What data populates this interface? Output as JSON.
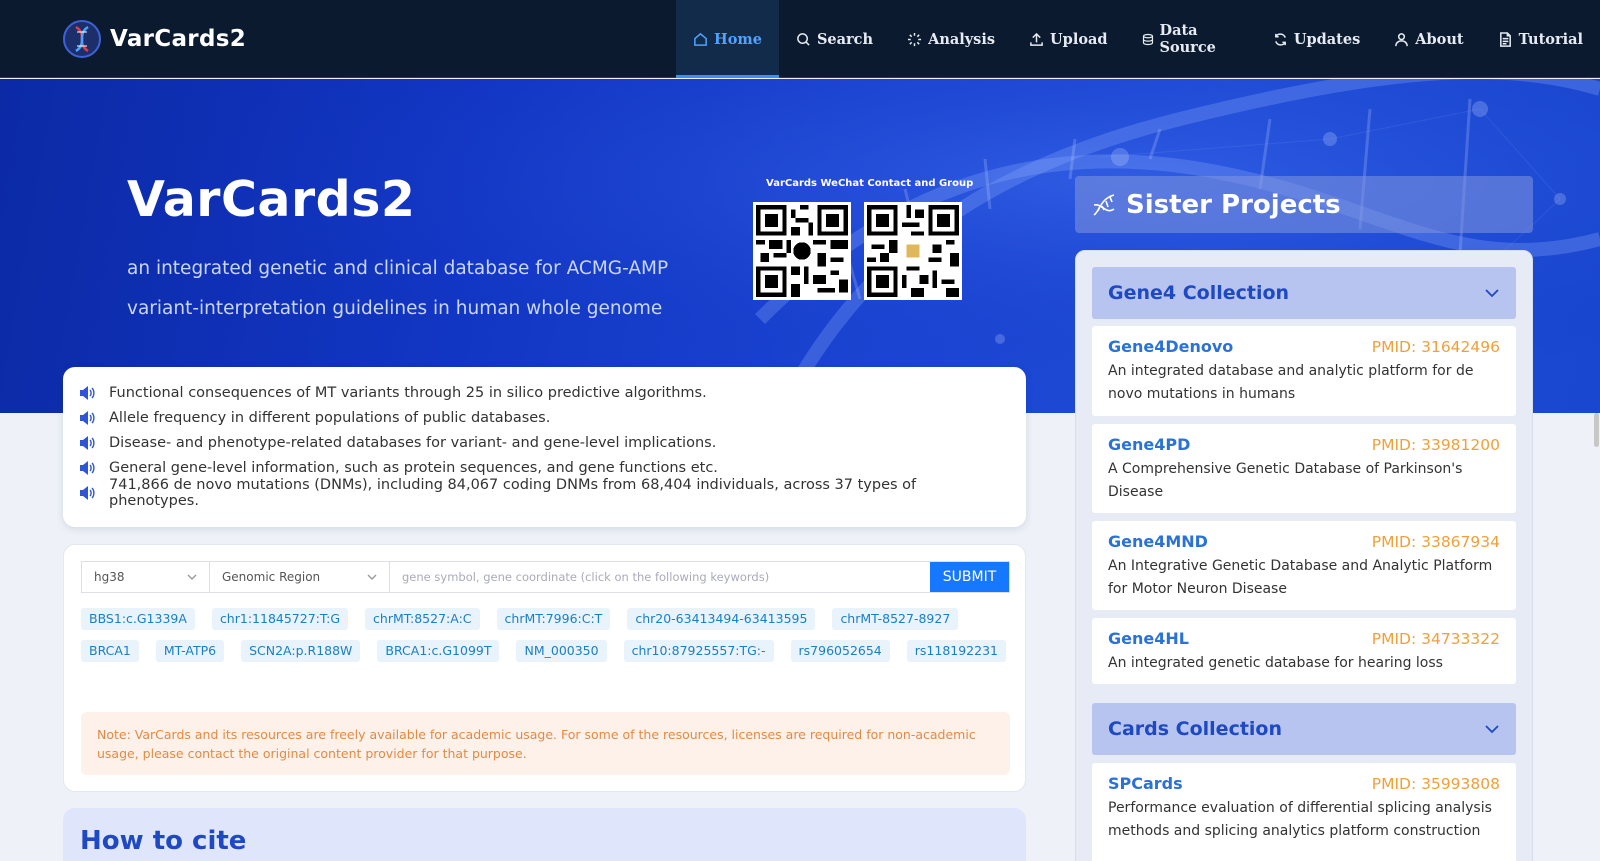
{
  "brand": {
    "name": "VarCards2"
  },
  "nav": [
    {
      "label": "Home",
      "icon": "home-icon"
    },
    {
      "label": "Search",
      "icon": "search-icon"
    },
    {
      "label": "Analysis",
      "icon": "loader-icon"
    },
    {
      "label": "Upload",
      "icon": "upload-icon"
    },
    {
      "label": "Data Source",
      "icon": "database-icon"
    },
    {
      "label": "Updates",
      "icon": "refresh-icon"
    },
    {
      "label": "About",
      "icon": "user-icon"
    },
    {
      "label": "Tutorial",
      "icon": "file-icon"
    }
  ],
  "hero": {
    "title": "VarCards2",
    "subtitle": "an integrated genetic and clinical database for ACMG-AMP variant-interpretation guidelines in human whole genome",
    "qr_caption": "VarCards WeChat Contact and Group"
  },
  "features": [
    "Functional consequences of MT variants through 25 in silico predictive algorithms.",
    "Allele frequency in different populations of public databases.",
    "Disease- and phenotype-related databases for variant- and gene-level implications.",
    "General gene-level information, such as protein sequences, and gene functions etc.",
    "741,866 de novo mutations (DNMs), including 84,067 coding DNMs from 68,404 individuals, across 37 types of phenotypes."
  ],
  "search": {
    "genome": "hg38",
    "mode": "Genomic Region",
    "placeholder": "gene symbol, gene coordinate (click on the following keywords)",
    "submit": "SUBMIT",
    "keywords": [
      "BBS1:c.G1339A",
      "chr1:11845727:T:G",
      "chrMT:8527:A:C",
      "chrMT:7996:C:T",
      "chr20-63413494-63413595",
      "chrMT-8527-8927",
      "BRCA1",
      "MT-ATP6",
      "SCN2A:p.R188W",
      "BRCA1:c.G1099T",
      "NM_000350",
      "chr10:87925557:TG:-",
      "rs796052654",
      "rs118192231"
    ],
    "note": "Note: VarCards and its resources are freely available for academic usage. For some of the resources, licenses are required for non-academic usage, please contact the original content provider for that purpose."
  },
  "cite": {
    "title": "How to cite"
  },
  "sister": {
    "title": "Sister Projects",
    "groups": [
      {
        "title": "Gene4 Collection",
        "projects": [
          {
            "name": "Gene4Denovo",
            "pmid": "PMID: 31642496",
            "desc": "An integrated database and analytic platform for de novo mutations in humans"
          },
          {
            "name": "Gene4PD",
            "pmid": "PMID: 33981200",
            "desc": "A Comprehensive Genetic Database of Parkinson's Disease"
          },
          {
            "name": "Gene4MND",
            "pmid": "PMID: 33867934",
            "desc": "An Integrative Genetic Database and Analytic Platform for Motor Neuron Disease"
          },
          {
            "name": "Gene4HL",
            "pmid": "PMID: 34733322",
            "desc": "An integrated genetic database for hearing loss"
          }
        ]
      },
      {
        "title": "Cards Collection",
        "projects": [
          {
            "name": "SPCards",
            "pmid": "PMID: 35993808",
            "desc": "Performance evaluation of differential splicing analysis methods and splicing analytics platform construction"
          }
        ]
      }
    ]
  },
  "colors": {
    "nav_bg": "#0b1a2e",
    "hero_blue": "#1236c4",
    "accent": "#1677ff",
    "pmid": "#f0a03a",
    "title_blue": "#1e49c3"
  }
}
